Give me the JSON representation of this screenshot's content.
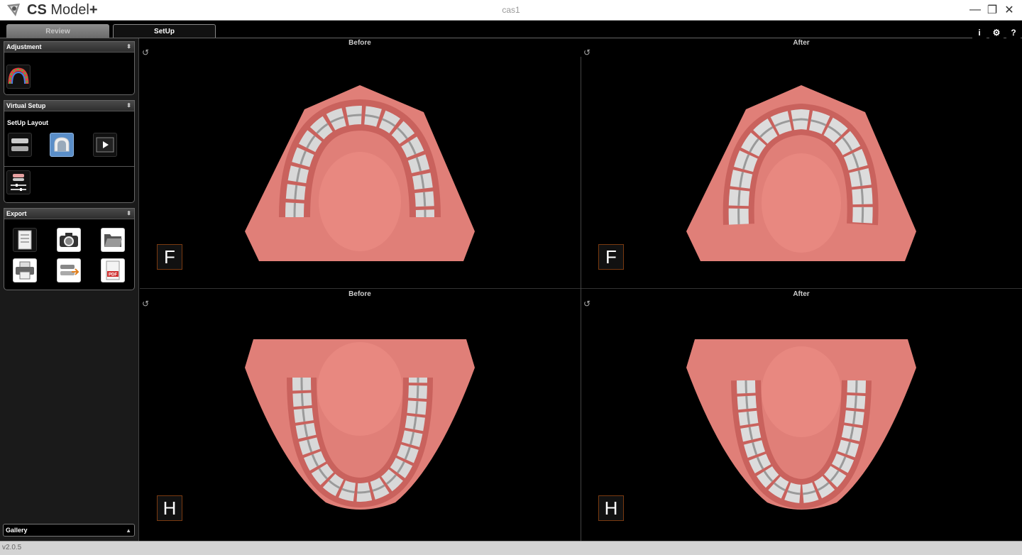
{
  "titlebar": {
    "app_name_bold": "CS",
    "app_name_rest": " Model",
    "app_name_plus": "+",
    "document": "cas1",
    "minimize": "—",
    "restore": "❐",
    "close": "✕"
  },
  "tabs": [
    {
      "label": "Review",
      "active": false
    },
    {
      "label": "SetUp",
      "active": true
    }
  ],
  "top_icons": {
    "info": "i",
    "settings": "⚙",
    "help": "?"
  },
  "sidebar": {
    "adjustment": {
      "title": "Adjustment",
      "collapse": "⬍"
    },
    "virtual_setup": {
      "title": "Virtual Setup",
      "collapse": "⬍",
      "layout_label": "SetUp Layout"
    },
    "export": {
      "title": "Export",
      "collapse": "⬍"
    },
    "gallery": {
      "title": "Gallery",
      "collapse": "▲"
    }
  },
  "viewports": [
    {
      "title": "Before",
      "orientation": "F",
      "reset": "↺"
    },
    {
      "title": "After",
      "orientation": "F",
      "reset": "↺"
    },
    {
      "title": "Before",
      "orientation": "H",
      "reset": "↺"
    },
    {
      "title": "After",
      "orientation": "H",
      "reset": "↺"
    }
  ],
  "status": {
    "version": "v2.0.5"
  },
  "colors": {
    "gum": "#e07f78",
    "gum_dark": "#c9625d",
    "tooth": "#d8d8d8",
    "accent_blue": "#5a8ec8",
    "orient_border": "#7a3a10"
  }
}
